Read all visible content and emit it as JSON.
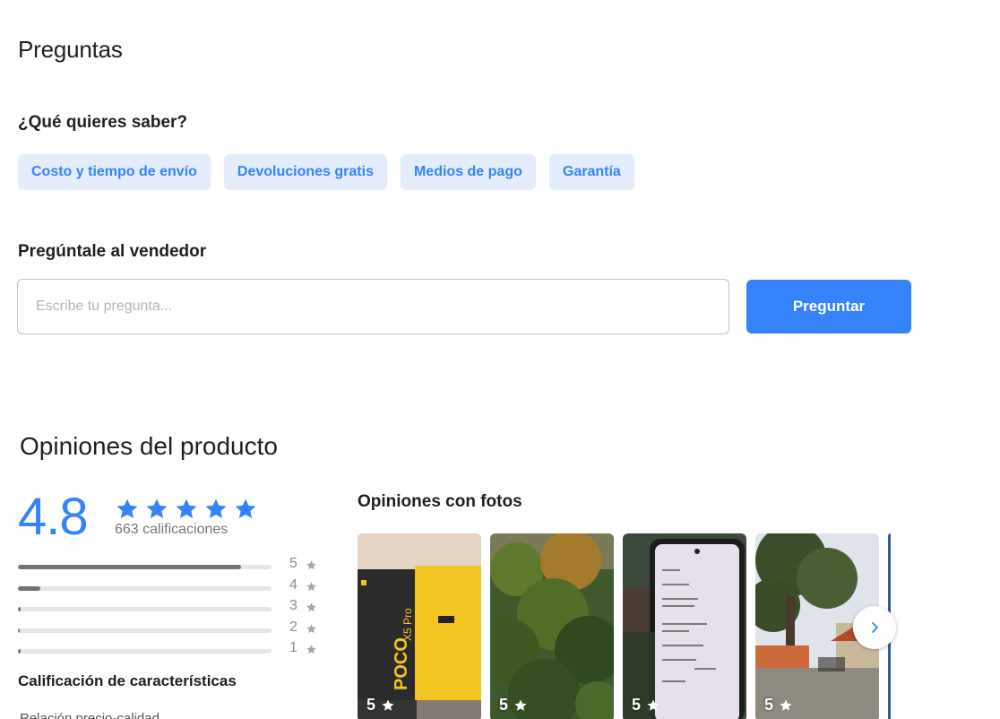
{
  "questions": {
    "title": "Preguntas",
    "subtitle": "¿Qué quieres saber?",
    "chips": [
      "Costo y tiempo de envío",
      "Devoluciones gratis",
      "Medios de pago",
      "Garantía"
    ],
    "ask_title": "Pregúntale al vendedor",
    "input_placeholder": "Escribe tu pregunta...",
    "ask_button": "Preguntar"
  },
  "reviews": {
    "title": "Opiniones del producto",
    "average": "4.8",
    "stars_filled": 5,
    "count_label": "663 calificaciones",
    "distribution": [
      {
        "label": "5",
        "fraction": 0.88
      },
      {
        "label": "4",
        "fraction": 0.09
      },
      {
        "label": "3",
        "fraction": 0.01
      },
      {
        "label": "2",
        "fraction": 0.005
      },
      {
        "label": "1",
        "fraction": 0.01
      }
    ],
    "features_title": "Calificación de características",
    "features_peek": "Relación precio-calidad",
    "photos_title": "Opiniones con fotos",
    "photos": [
      {
        "rating": "5",
        "icon": "poco-x5-pro-box-photo"
      },
      {
        "rating": "5",
        "icon": "plants-photo"
      },
      {
        "rating": "5",
        "icon": "phone-screen-photo"
      },
      {
        "rating": "5",
        "icon": "tree-plaza-photo"
      }
    ]
  },
  "colors": {
    "accent": "#3483fa",
    "chip_bg": "#e3edfb",
    "bar_fill": "#737373",
    "muted": "#8c8c8c"
  }
}
